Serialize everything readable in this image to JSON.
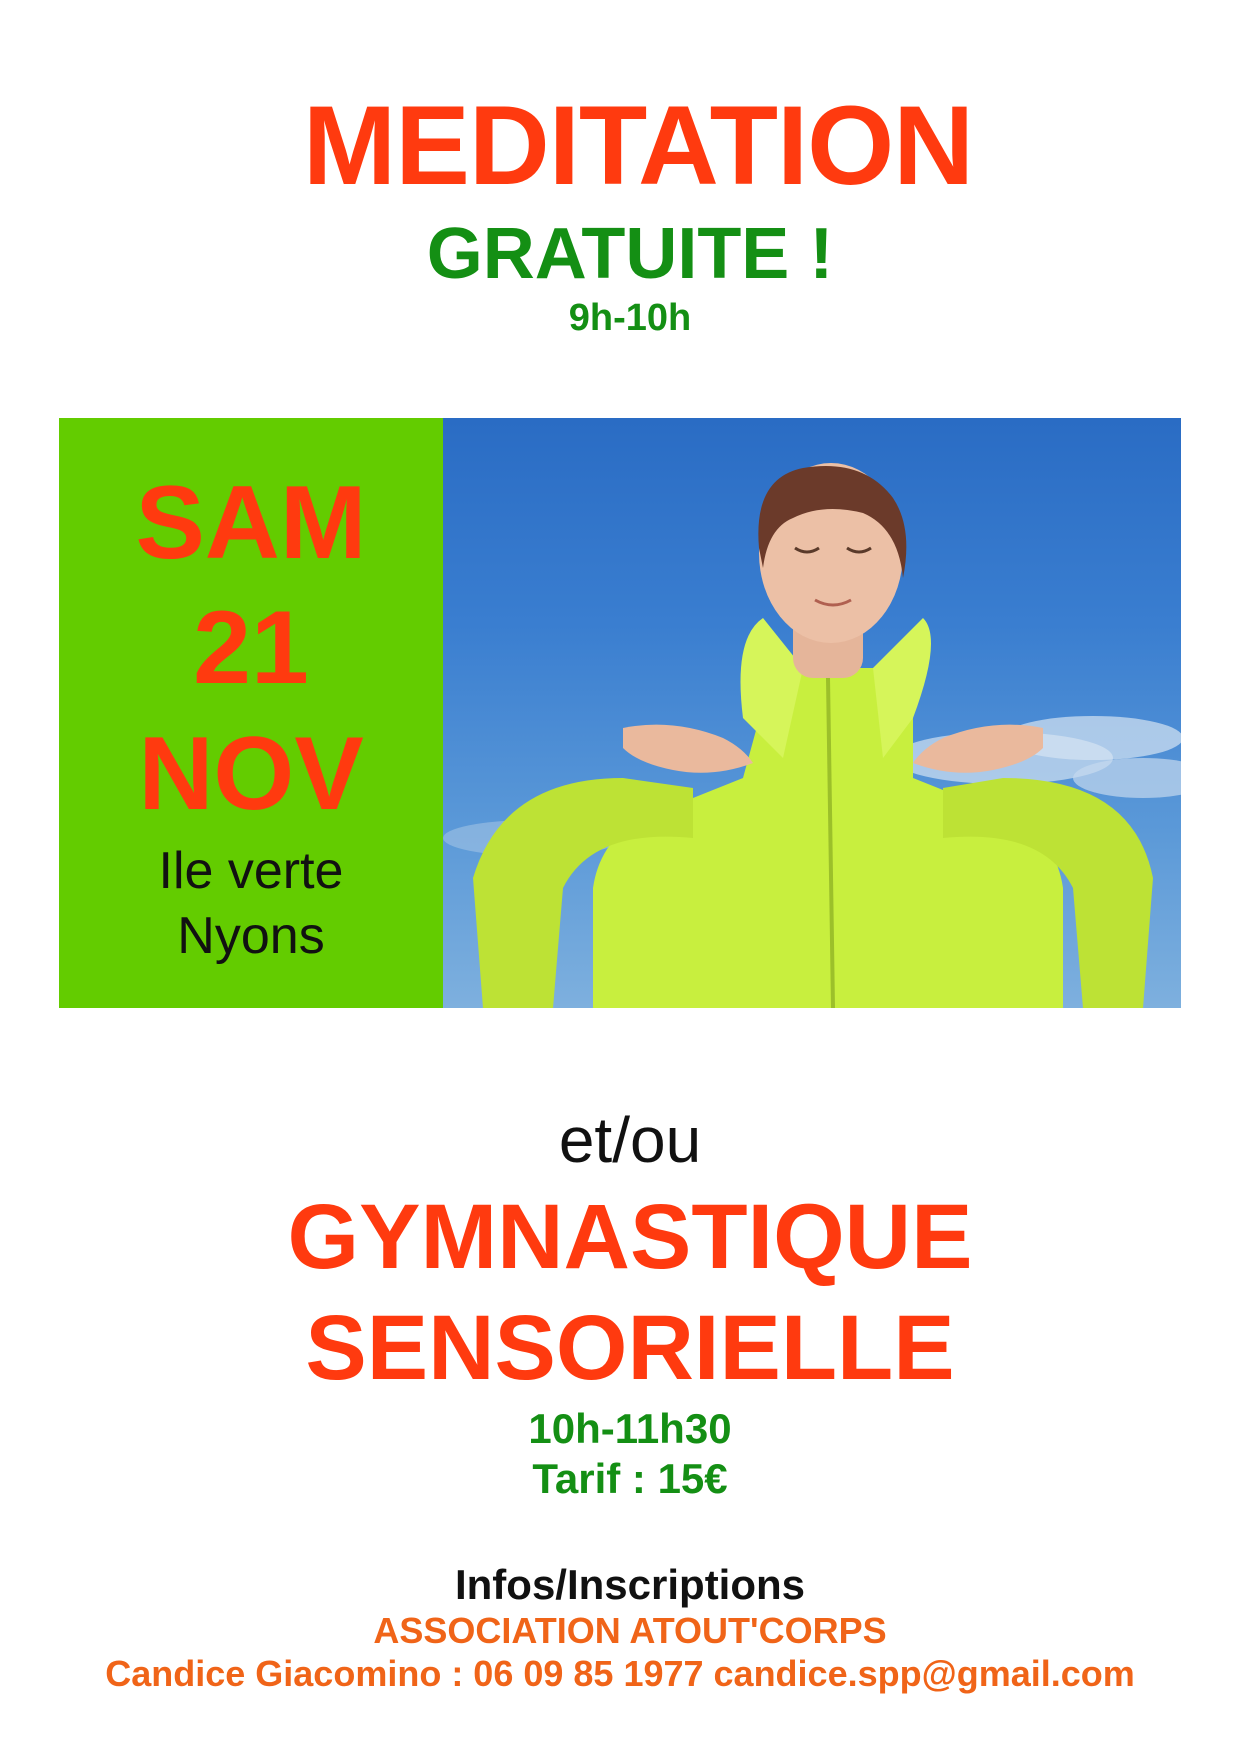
{
  "header": {
    "title": "MEDITATION",
    "subtitle": "GRATUITE !",
    "time": "9h-10h"
  },
  "event": {
    "day": "SAM",
    "date": "21",
    "month": "NOV",
    "place_line_1": "Ile verte",
    "place_line_2": "Nyons"
  },
  "second_activity": {
    "connector": "et/ou",
    "title_line_1": "GYMNASTIQUE",
    "title_line_2": "SENSORIELLE",
    "time": "10h-11h30",
    "price": "Tarif : 15€"
  },
  "footer": {
    "infos": "Infos/Inscriptions",
    "association": "ASSOCIATION ATOUT'CORPS",
    "contact": "Candice Giacomino : 06 09 85 1977 candice.spp@gmail.com"
  },
  "colors": {
    "accent_orange": "#ff3a0f",
    "accent_green": "#148f14",
    "date_block_green": "#63cc00",
    "contact_orange": "#f06418"
  },
  "photo": {
    "subject": "woman with closed eyes in lime green jacket, hands at chest, blue sky"
  }
}
